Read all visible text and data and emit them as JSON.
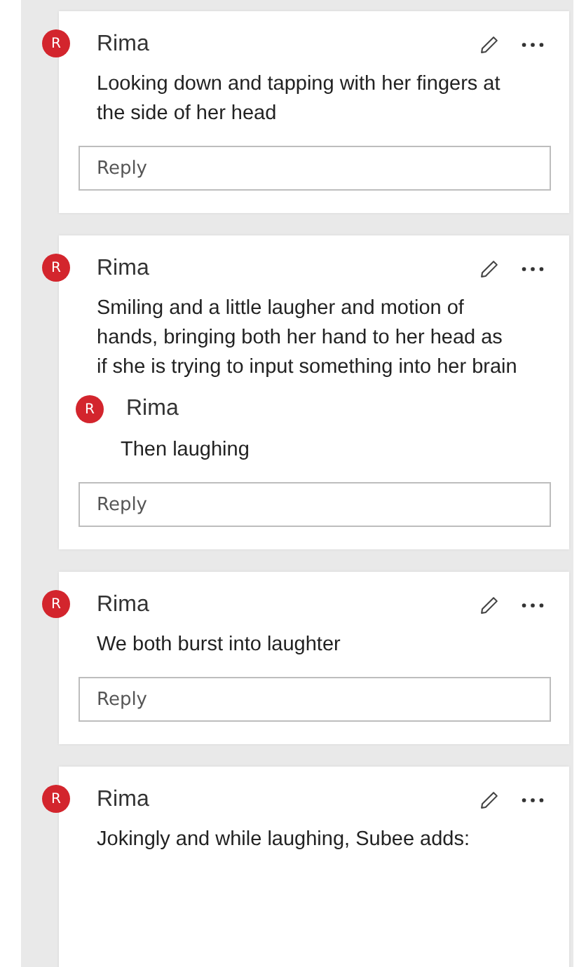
{
  "comments": [
    {
      "initial": "R",
      "author": "Rima",
      "text": "Looking down and tapping with her fingers at the side of her head",
      "reply_placeholder": "Reply"
    },
    {
      "initial": "R",
      "author": "Rima",
      "text": "Smiling and a little laugher and motion of hands, bringing both her hand to her head as if she is trying to input something into her brain",
      "replies": [
        {
          "initial": "R",
          "author": "Rima",
          "text": "Then laughing"
        }
      ],
      "reply_placeholder": "Reply"
    },
    {
      "initial": "R",
      "author": "Rima",
      "text": "We both burst into laughter",
      "reply_placeholder": "Reply"
    },
    {
      "initial": "R",
      "author": "Rima",
      "text": "Jokingly and while laughing, Subee adds:"
    }
  ]
}
